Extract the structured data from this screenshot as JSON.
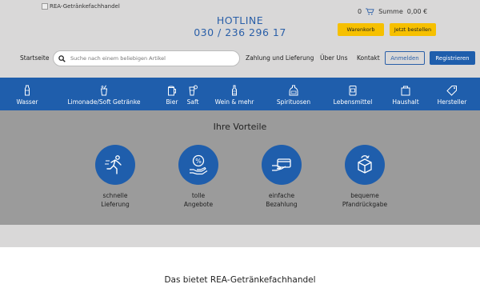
{
  "header": {
    "logo_alt": "REA-Getränkefachhandel",
    "hotline_label": "HOTLINE",
    "hotline_number": "030 / 236 296 17",
    "cart_count": "0",
    "summe_label": "Summe",
    "summe_value": "0,00 €",
    "warenkorb_label": "Warenkorb",
    "bestellen_label": "Jetzt bestellen"
  },
  "nav": {
    "startseite": "Startseite",
    "search_placeholder": "Suche nach einem beliebigen Artikel",
    "links": [
      "Zahlung und Lieferung",
      "Über Uns",
      "Kontakt"
    ],
    "anmelden": "Anmelden",
    "registrieren": "Registrieren"
  },
  "categories": [
    {
      "label": "Wasser",
      "icon": "water-bottle-icon"
    },
    {
      "label": "Limonade/Soft Getränke",
      "icon": "soda-cup-icon"
    },
    {
      "label": "Bier",
      "icon": "beer-mug-icon"
    },
    {
      "label": "Saft",
      "icon": "juice-glass-icon"
    },
    {
      "label": "Wein & mehr",
      "icon": "wine-bottle-icon"
    },
    {
      "label": "Spirituosen",
      "icon": "spirits-bottle-icon"
    },
    {
      "label": "Lebensmittel",
      "icon": "food-jar-icon"
    },
    {
      "label": "Haushalt",
      "icon": "household-box-icon"
    },
    {
      "label": "Hersteller",
      "icon": "tag-icon"
    }
  ],
  "vorteile": {
    "title": "Ihre Vorteile",
    "items": [
      {
        "line1": "schnelle",
        "line2": "Lieferung",
        "icon": "running-person-icon"
      },
      {
        "line1": "tolle",
        "line2": "Angebote",
        "icon": "discount-hand-icon"
      },
      {
        "line1": "einfache",
        "line2": "Bezahlung",
        "icon": "card-payment-icon"
      },
      {
        "line1": "bequeme",
        "line2": "Pfandrückgabe",
        "icon": "box-return-icon"
      }
    ]
  },
  "bietet_title": "Das bietet REA-Getränkefachhandel",
  "colors": {
    "primary_blue": "#1f5eac",
    "accent_yellow": "#f6c000",
    "header_gray": "#d9d8d8",
    "vorteile_gray": "#9b9b9b"
  }
}
